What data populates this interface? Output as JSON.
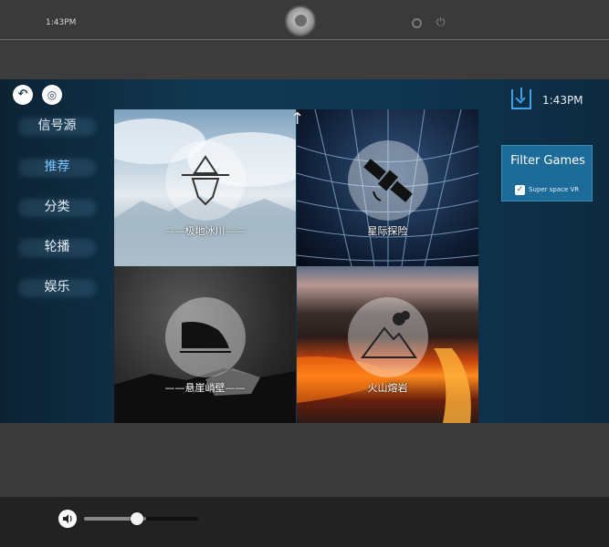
{
  "status_bar": {
    "time": "1:43PM",
    "avatar_icon": "profile-avatar",
    "settings_icon": "gear-icon",
    "power_icon": "power-icon"
  },
  "header": {
    "back_icon": "back-arrow-icon",
    "home_icon": "fingerprint-icon",
    "download_icon": "download-icon",
    "time": "1:43PM"
  },
  "nav": {
    "items": [
      {
        "label": "信号源",
        "active": false
      },
      {
        "label": "推荐",
        "active": true
      },
      {
        "label": "分类",
        "active": false
      },
      {
        "label": "轮播",
        "active": false
      },
      {
        "label": "娱乐",
        "active": false
      }
    ]
  },
  "tiles": [
    {
      "caption": "——极地冰川——",
      "icon": "iceberg-icon"
    },
    {
      "caption": "星际探险",
      "icon": "satellite-icon"
    },
    {
      "caption": "——悬崖峭壁——",
      "icon": "cliff-wave-icon"
    },
    {
      "caption": "火山熔岩",
      "icon": "volcano-icon"
    }
  ],
  "filter": {
    "title": "Filter Games",
    "option": "Super space VR",
    "option_checked": true
  },
  "volume": {
    "icon": "speaker-icon",
    "level": 0.4
  },
  "colors": {
    "accent": "#3fa3e8",
    "filter_bg": "#1d6b98",
    "nav_active": "#7fc6ff"
  }
}
